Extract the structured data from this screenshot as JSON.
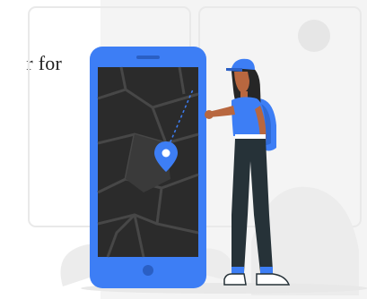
{
  "intro": {
    "fragment_start": "r",
    "fragment_word": "for"
  },
  "illustration": {
    "subject": "woman-with-phone-map",
    "colors": {
      "accent_blue": "#3d7ef5",
      "phone_body": "#3d7ef5",
      "screen_bg": "#2b2b2b",
      "map_roads": "#4a4a4a",
      "pin": "#3d7ef5",
      "skin": "#b8673f",
      "hair": "#262626",
      "shirt": "#3d7ef5",
      "pants": "#263238",
      "background_shapes": "#ececec"
    }
  }
}
